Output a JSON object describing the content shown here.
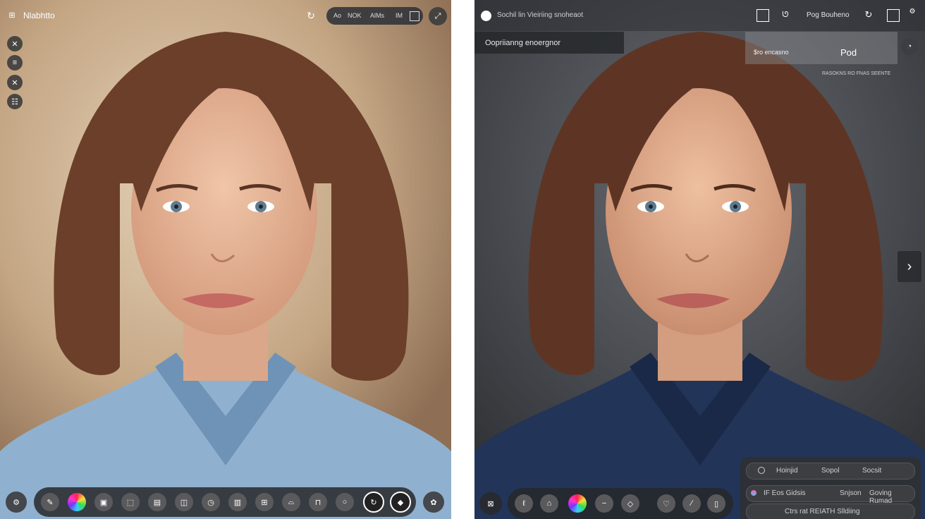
{
  "left": {
    "app_title": "Nlabhtto",
    "header_icon": "grid-icon",
    "pill_items": [
      "Ao",
      "NOK",
      "AlMs",
      "IM"
    ],
    "side_tools": [
      "close-icon",
      "menu-icon",
      "close-icon",
      "list-icon"
    ],
    "dock_tools": [
      "pen-icon",
      "color-wheel-icon",
      "image-icon",
      "frame-icon",
      "layout-icon",
      "split-icon",
      "timer-icon",
      "panel-icon",
      "grid-icon",
      "crop-icon",
      "adjust-icon",
      "zoom-icon",
      "refresh-icon",
      "target-icon"
    ]
  },
  "right": {
    "header_title": "Sochil lin Vieiriing snoheaot",
    "header_action": "Pog Bouheno",
    "dropdown_label": "Oopriianng enoergnor",
    "preset": {
      "prefix": "$ro encasno",
      "name": "Pod",
      "caption": "RASOKNS RO FNAS SEENTE"
    },
    "panel_rows": [
      [
        "Hoinjid",
        "Sopol",
        "Socsit"
      ],
      [
        "IF Eos Gidsis",
        "Snjson",
        "Goving Rumad"
      ],
      [
        "Ctrs rat REIATH Slldiing"
      ]
    ],
    "dock_tools": [
      "brush-icon",
      "mushroom-icon",
      "color-wheel-icon",
      "minus-icon",
      "visibility-icon",
      "heart-icon",
      "slash-icon",
      "bar-icon"
    ]
  },
  "colors": {
    "accent": "#4a90e2",
    "dock": "#2a2a2c",
    "panel": "#2e3034"
  }
}
